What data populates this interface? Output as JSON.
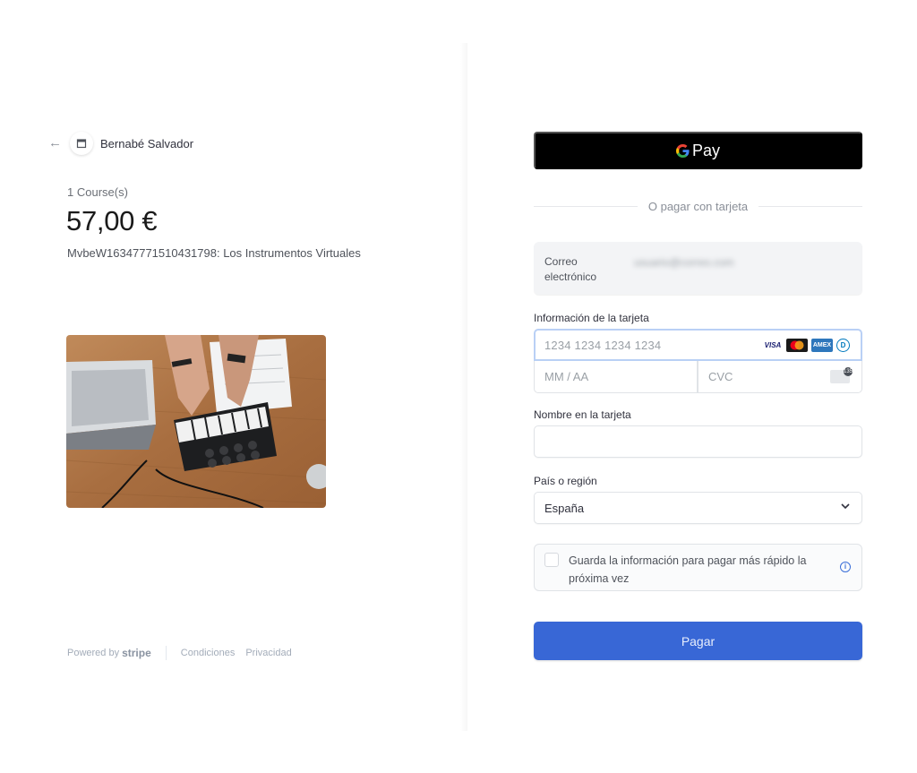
{
  "merchant": {
    "name": "Bernabé Salvador",
    "back_icon": "arrow-left-icon",
    "logo_icon": "store-icon"
  },
  "product": {
    "quantity_label": "1 Course(s)",
    "price": "57,00 €",
    "description": "MvbeW16347771510431798: Los Instrumentos Virtuales"
  },
  "footer": {
    "powered_by": "Powered by",
    "brand": "stripe",
    "terms": "Condiciones",
    "privacy": "Privacidad"
  },
  "payment": {
    "gpay_g": "G",
    "gpay_label": "Pay",
    "or_text": "O pagar con tarjeta",
    "email_label": "Correo electrónico",
    "email_value": "usuario@correo.com",
    "card_label": "Información de la tarjeta",
    "card_placeholder": "1234 1234 1234 1234",
    "brands": [
      "VISA",
      "Mastercard",
      "AMEX",
      "Diners"
    ],
    "expiry_placeholder": "MM / AA",
    "cvc_placeholder": "CVC",
    "name_label": "Nombre en la tarjeta",
    "name_value": "",
    "country_label": "País o región",
    "country_value": "España",
    "save_text": "Guarda la información para pagar más rápido la próxima vez",
    "pay_button": "Pagar"
  },
  "colors": {
    "pay_button": "#3867d6",
    "gpay_bg": "#000000",
    "focus_border": "#b9d0f5"
  }
}
